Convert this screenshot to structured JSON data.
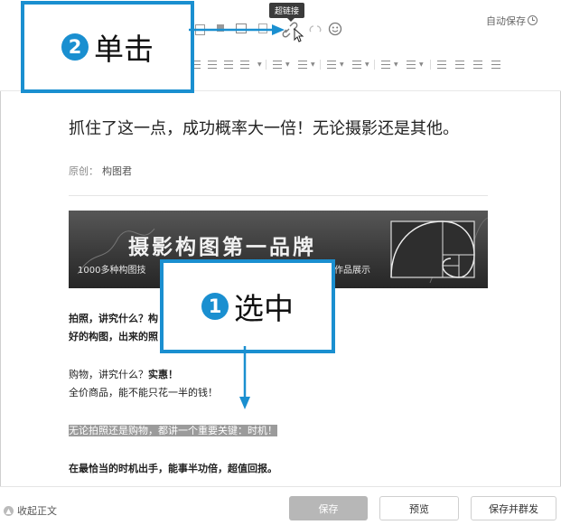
{
  "toolbar": {
    "tooltip": "超链接",
    "autosave": "自动保存"
  },
  "callouts": {
    "click": {
      "number": "2",
      "label": "单击"
    },
    "select": {
      "number": "1",
      "label": "选中"
    }
  },
  "article": {
    "title": "抓住了这一点，成功概率大一倍！无论摄影还是其他。",
    "author_label": "原创：",
    "author_name": "构图君",
    "banner_title": "摄影构图第一品牌",
    "banner_sub_left": "1000多种构图技",
    "banner_sub_right": "作品展示",
    "paragraphs": [
      {
        "line1": "拍照，讲究什么？构",
        "line2": "好的构图，出来的照"
      },
      {
        "line1": "购物，讲究什么？",
        "line1_em": "实惠！",
        "line2": "全价商品，能不能只花一半的钱！"
      }
    ],
    "highlight": "无论拍照还是购物，都讲一个重要关键：时机！",
    "last_line": "在最恰当的时机出手，能事半功倍，超值回报。"
  },
  "footer": {
    "collapse": "收起正文",
    "save": "保存",
    "preview": "预览",
    "publish": "保存并群发"
  },
  "colors": {
    "accent": "#1a8fd0",
    "save_button": "#b7b7b7",
    "highlight_bg": "#9b9b9b"
  }
}
